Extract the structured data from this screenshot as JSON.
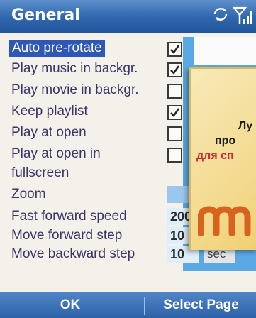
{
  "window": {
    "title": "General"
  },
  "settings": [
    {
      "label": "Auto pre-rotate",
      "control": "checkbox",
      "checked": true,
      "selected": true
    },
    {
      "label": "Play music in backgr.",
      "control": "checkbox",
      "checked": true
    },
    {
      "label": "Play movie in backgr.",
      "control": "checkbox",
      "checked": false
    },
    {
      "label": "Keep playlist",
      "control": "checkbox",
      "checked": true
    },
    {
      "label": "Play at open",
      "control": "checkbox",
      "checked": false
    },
    {
      "label": "Play at open in",
      "control": "checkbox",
      "checked": false
    },
    {
      "label": "fullscreen",
      "control": "none"
    },
    {
      "label": "Zoom",
      "control": "dropdown"
    },
    {
      "label": "Fast forward speed",
      "control": "number",
      "value": "200"
    },
    {
      "label": "Move forward step",
      "control": "number",
      "value": "10",
      "unit": "sec"
    },
    {
      "label": "Move backward step",
      "control": "number",
      "value": "10",
      "unit": "sec"
    }
  ],
  "promo": {
    "line1": "Лу",
    "line2": "про",
    "line3": "для сп"
  },
  "softkeys": {
    "left": "OK",
    "right": "Select Page"
  },
  "icons": {
    "rotate": "rotate-icon",
    "signal": "signal-icon",
    "check": "checkmark-icon"
  },
  "colors": {
    "titlebar": "#2f66ad",
    "selection": "#2f58b6",
    "label_text": "#3b3466",
    "promo_red": "#cc2d2d"
  }
}
